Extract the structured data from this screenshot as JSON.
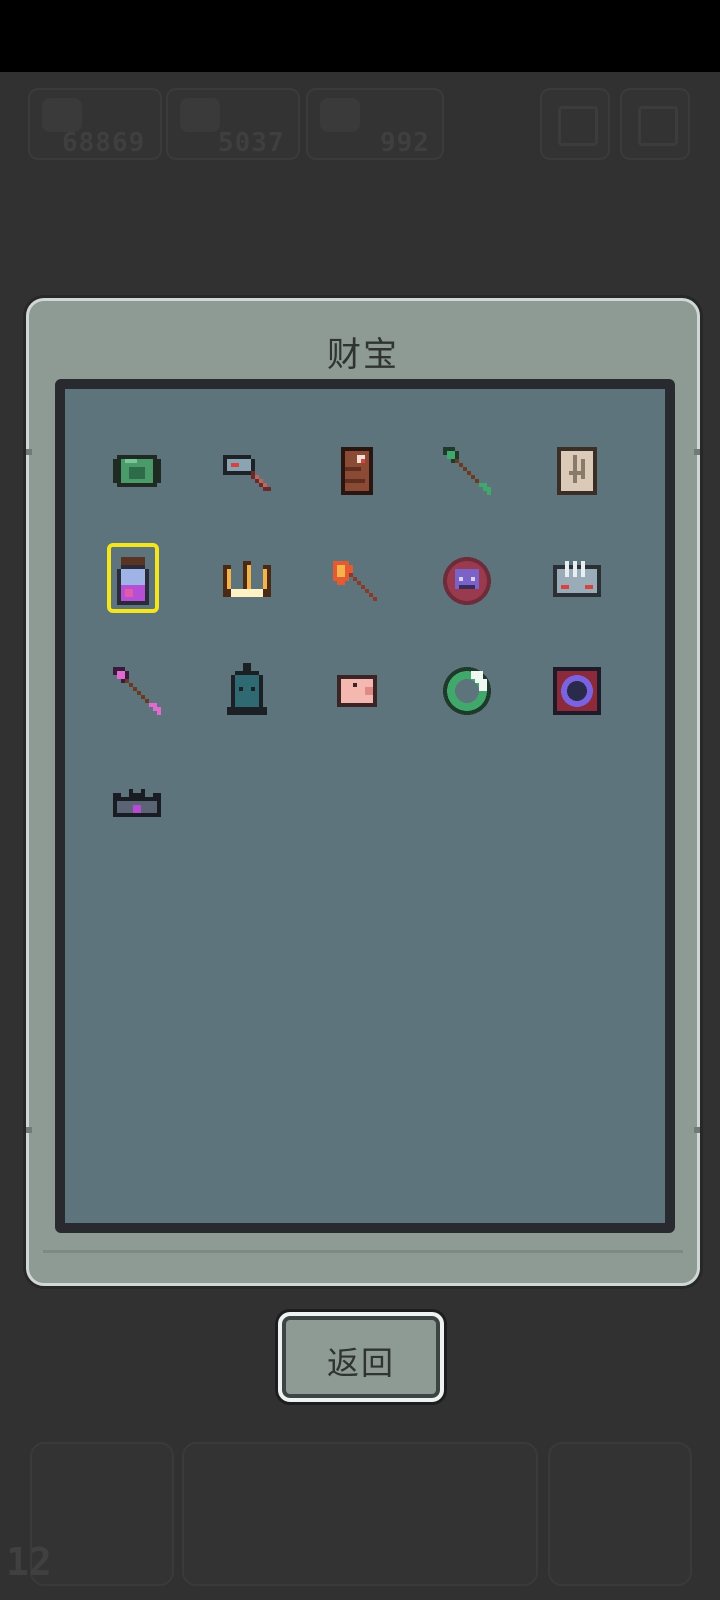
{
  "hud": {
    "resources": [
      {
        "icon": "meat-icon",
        "value": "68869"
      },
      {
        "icon": "log-icon",
        "value": "5037"
      },
      {
        "icon": "clover-icon",
        "value": "992"
      }
    ],
    "buttons": [
      "add-icon",
      "menu-icon"
    ]
  },
  "panel": {
    "title": "财宝",
    "items": [
      {
        "name": "turtle-shell-icon"
      },
      {
        "name": "hammer-icon"
      },
      {
        "name": "wooden-totem-icon"
      },
      {
        "name": "green-arrow-icon"
      },
      {
        "name": "ancient-map-icon"
      },
      {
        "name": "potion-jar-icon",
        "selected": true
      },
      {
        "name": "golden-trident-icon"
      },
      {
        "name": "fire-axe-icon"
      },
      {
        "name": "demon-mask-icon"
      },
      {
        "name": "stone-gauntlet-icon"
      },
      {
        "name": "pink-arrow-icon"
      },
      {
        "name": "iron-bell-icon"
      },
      {
        "name": "piggy-icon"
      },
      {
        "name": "jade-ring-icon"
      },
      {
        "name": "purple-portal-icon"
      },
      {
        "name": "dark-crown-icon"
      }
    ]
  },
  "back_button": {
    "label": "返回"
  },
  "bottom": {
    "level": "12"
  }
}
